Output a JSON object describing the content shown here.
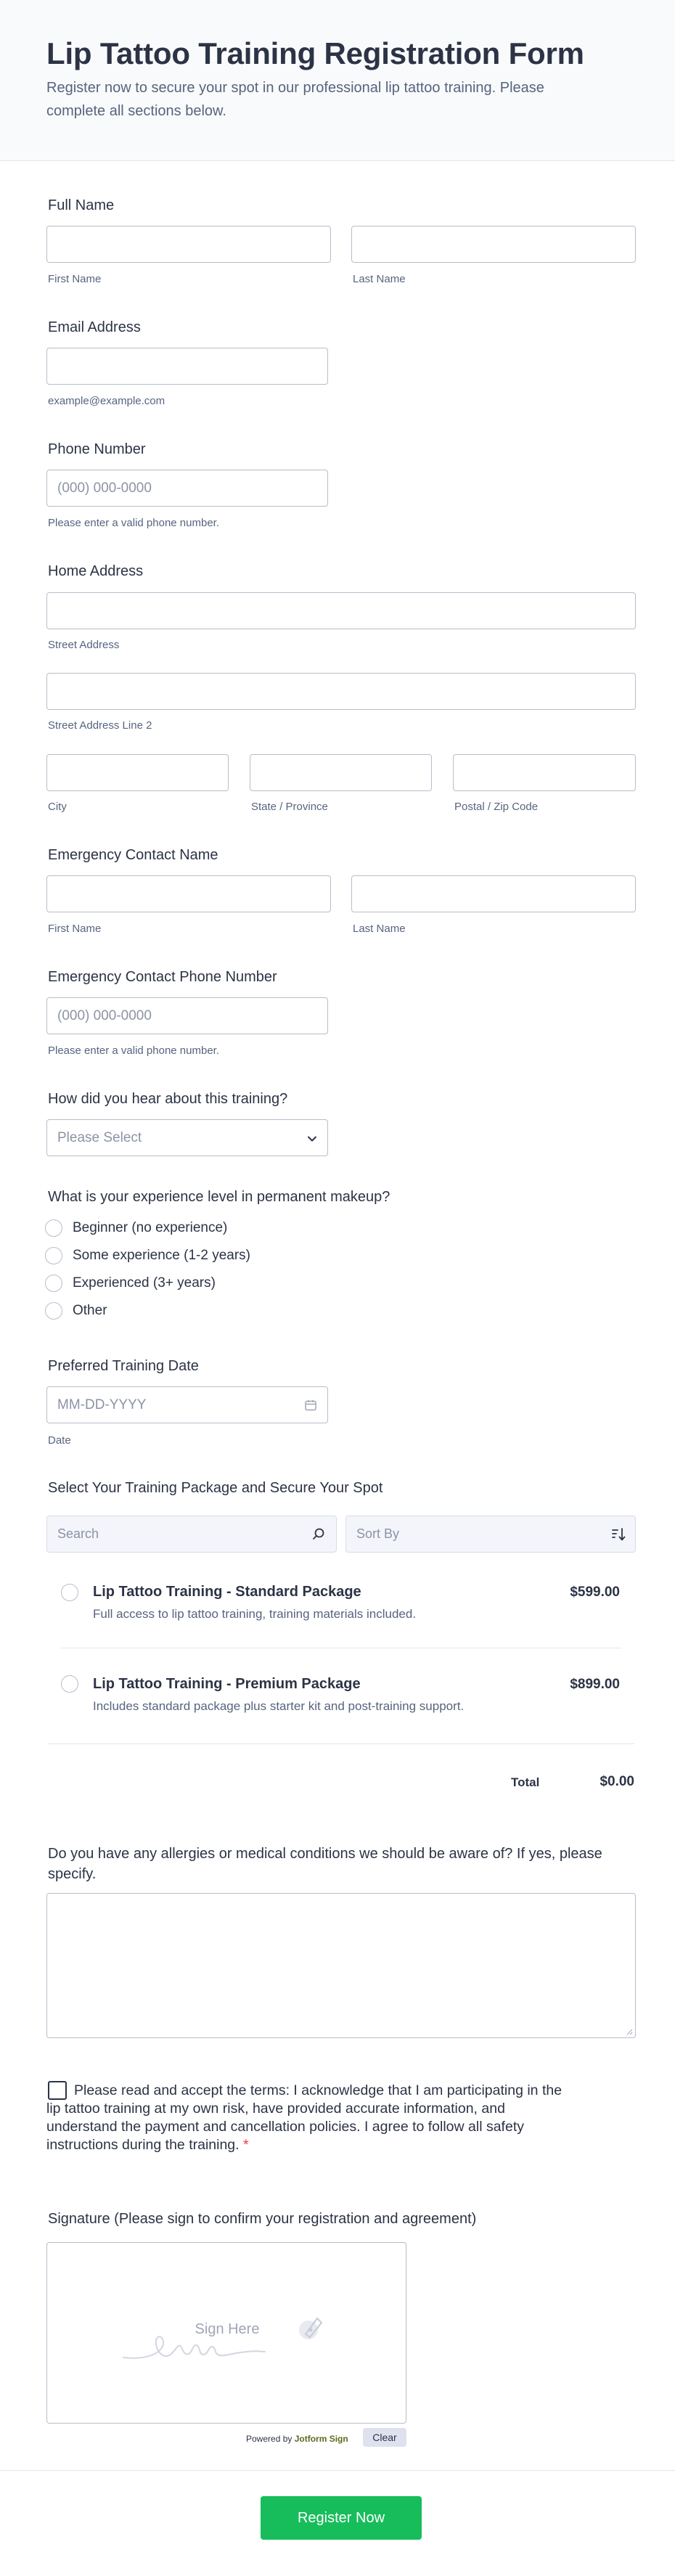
{
  "header": {
    "title": "Lip Tattoo Training Registration Form",
    "subtitle": "Register now to secure your spot in our professional lip tattoo training. Please complete all sections below."
  },
  "full_name": {
    "label": "Full Name",
    "first": "First Name",
    "last": "Last Name"
  },
  "email": {
    "label": "Email Address",
    "sublabel": "example@example.com"
  },
  "phone": {
    "label": "Phone Number",
    "placeholder": "(000) 000-0000",
    "sublabel": "Please enter a valid phone number."
  },
  "address": {
    "label": "Home Address",
    "street": "Street Address",
    "street2": "Street Address Line 2",
    "city": "City",
    "state": "State / Province",
    "zip": "Postal / Zip Code"
  },
  "emergency_name": {
    "label": "Emergency Contact Name",
    "first": "First Name",
    "last": "Last Name"
  },
  "emergency_phone": {
    "label": "Emergency Contact Phone Number",
    "placeholder": "(000) 000-0000",
    "sublabel": "Please enter a valid phone number."
  },
  "heard": {
    "label": "How did you hear about this training?",
    "placeholder": "Please Select"
  },
  "experience": {
    "label": "What is your experience level in permanent makeup?",
    "options": [
      "Beginner (no experience)",
      "Some experience (1-2 years)",
      "Experienced (3+ years)",
      "Other"
    ]
  },
  "date": {
    "label": "Preferred Training Date",
    "placeholder": "MM-DD-YYYY",
    "sublabel": "Date"
  },
  "package": {
    "label": "Select Your Training Package and Secure Your Spot",
    "search_placeholder": "Search",
    "sort_placeholder": "Sort By",
    "products": [
      {
        "name": "Lip Tattoo Training - Standard Package",
        "desc": "Full access to lip tattoo training, training materials included.",
        "price": "$599.00"
      },
      {
        "name": "Lip Tattoo Training - Premium Package",
        "desc": "Includes standard package plus starter kit and post-training support.",
        "price": "$899.00"
      }
    ],
    "total_label": "Total",
    "total_value": "$0.00"
  },
  "allergies": {
    "label": "Do you have any allergies or medical conditions we should be aware of? If yes, please specify."
  },
  "terms": {
    "text": "Please read and accept the terms: I acknowledge that I am participating in the lip tattoo training at my own risk, have provided accurate information, and understand the payment and cancellation policies. I agree to follow all safety instructions during the training.",
    "required_mark": "*"
  },
  "signature": {
    "label": "Signature (Please sign to confirm your registration and agreement)",
    "placeholder": "Sign Here",
    "powered_prefix": "Powered by",
    "powered_brand": "Jotform Sign",
    "clear_label": "Clear"
  },
  "submit_label": "Register Now",
  "colors": {
    "accent": "#18bd5b",
    "required": "#f23a3c",
    "text": "#2c3345",
    "muted": "#57647e"
  }
}
